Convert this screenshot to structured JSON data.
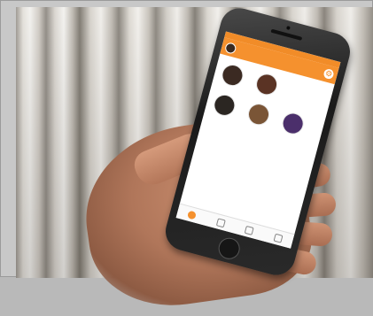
{
  "photo": {
    "subject": "hand-holding-smartphone"
  },
  "app": {
    "header_title": "",
    "sections": [
      {
        "title": "",
        "members": [
          {
            "name": "",
            "subtitle": "",
            "avatar_color": "#3b2a22"
          },
          {
            "name": "",
            "subtitle": "",
            "avatar_color": "#5a3324"
          }
        ]
      },
      {
        "title": "",
        "members": [
          {
            "name": "",
            "subtitle": "",
            "avatar_color": "#2b2622"
          },
          {
            "name": "",
            "subtitle": "",
            "avatar_color": "#7a5536"
          },
          {
            "name": "",
            "subtitle": "",
            "avatar_color": "#4b2f6b"
          }
        ]
      }
    ],
    "tabs": [
      {
        "icon": "home-icon",
        "active": true
      },
      {
        "icon": "list-icon",
        "active": false
      },
      {
        "icon": "calendar-icon",
        "active": false
      },
      {
        "icon": "profile-icon",
        "active": false
      }
    ]
  },
  "colors": {
    "accent": "#f5912e",
    "background": "#ffffff"
  }
}
